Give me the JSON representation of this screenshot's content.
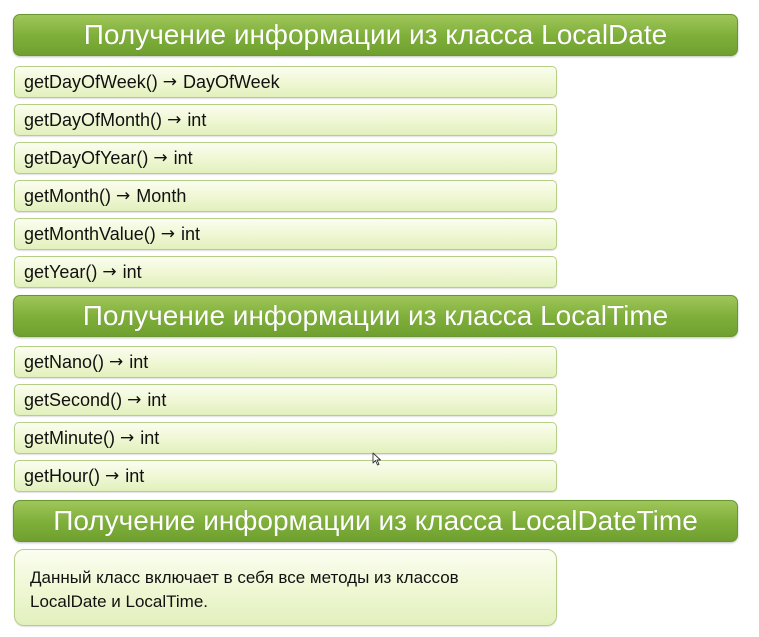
{
  "sections": {
    "local_date": {
      "title": "Получение информации из класса LocalDate",
      "items": [
        {
          "method": "getDayOfWeek()",
          "returns": "DayOfWeek"
        },
        {
          "method": "getDayOfMonth()",
          "returns": "int"
        },
        {
          "method": "getDayOfYear()",
          "returns": "int"
        },
        {
          "method": "getMonth()",
          "returns": "Month"
        },
        {
          "method": "getMonthValue()",
          "returns": "int"
        },
        {
          "method": "getYear()",
          "returns": "int"
        }
      ]
    },
    "local_time": {
      "title": "Получение информации из класса LocalTime",
      "items": [
        {
          "method": "getNano()",
          "returns": "int"
        },
        {
          "method": "getSecond()",
          "returns": "int"
        },
        {
          "method": "getMinute()",
          "returns": "int"
        },
        {
          "method": "getHour()",
          "returns": "int"
        }
      ]
    },
    "local_date_time": {
      "title": "Получение информации из класса LocalDateTime",
      "description_line1": "Данный класс включает в себя все методы из классов",
      "description_line2": "LocalDate и LocalTime."
    }
  },
  "arrow_glyph": "→",
  "icons": {
    "cursor": "mouse-pointer-icon"
  },
  "colors": {
    "header_green": "#80b03b",
    "item_fill": "#eef7d2",
    "item_border": "#b6cf86"
  }
}
